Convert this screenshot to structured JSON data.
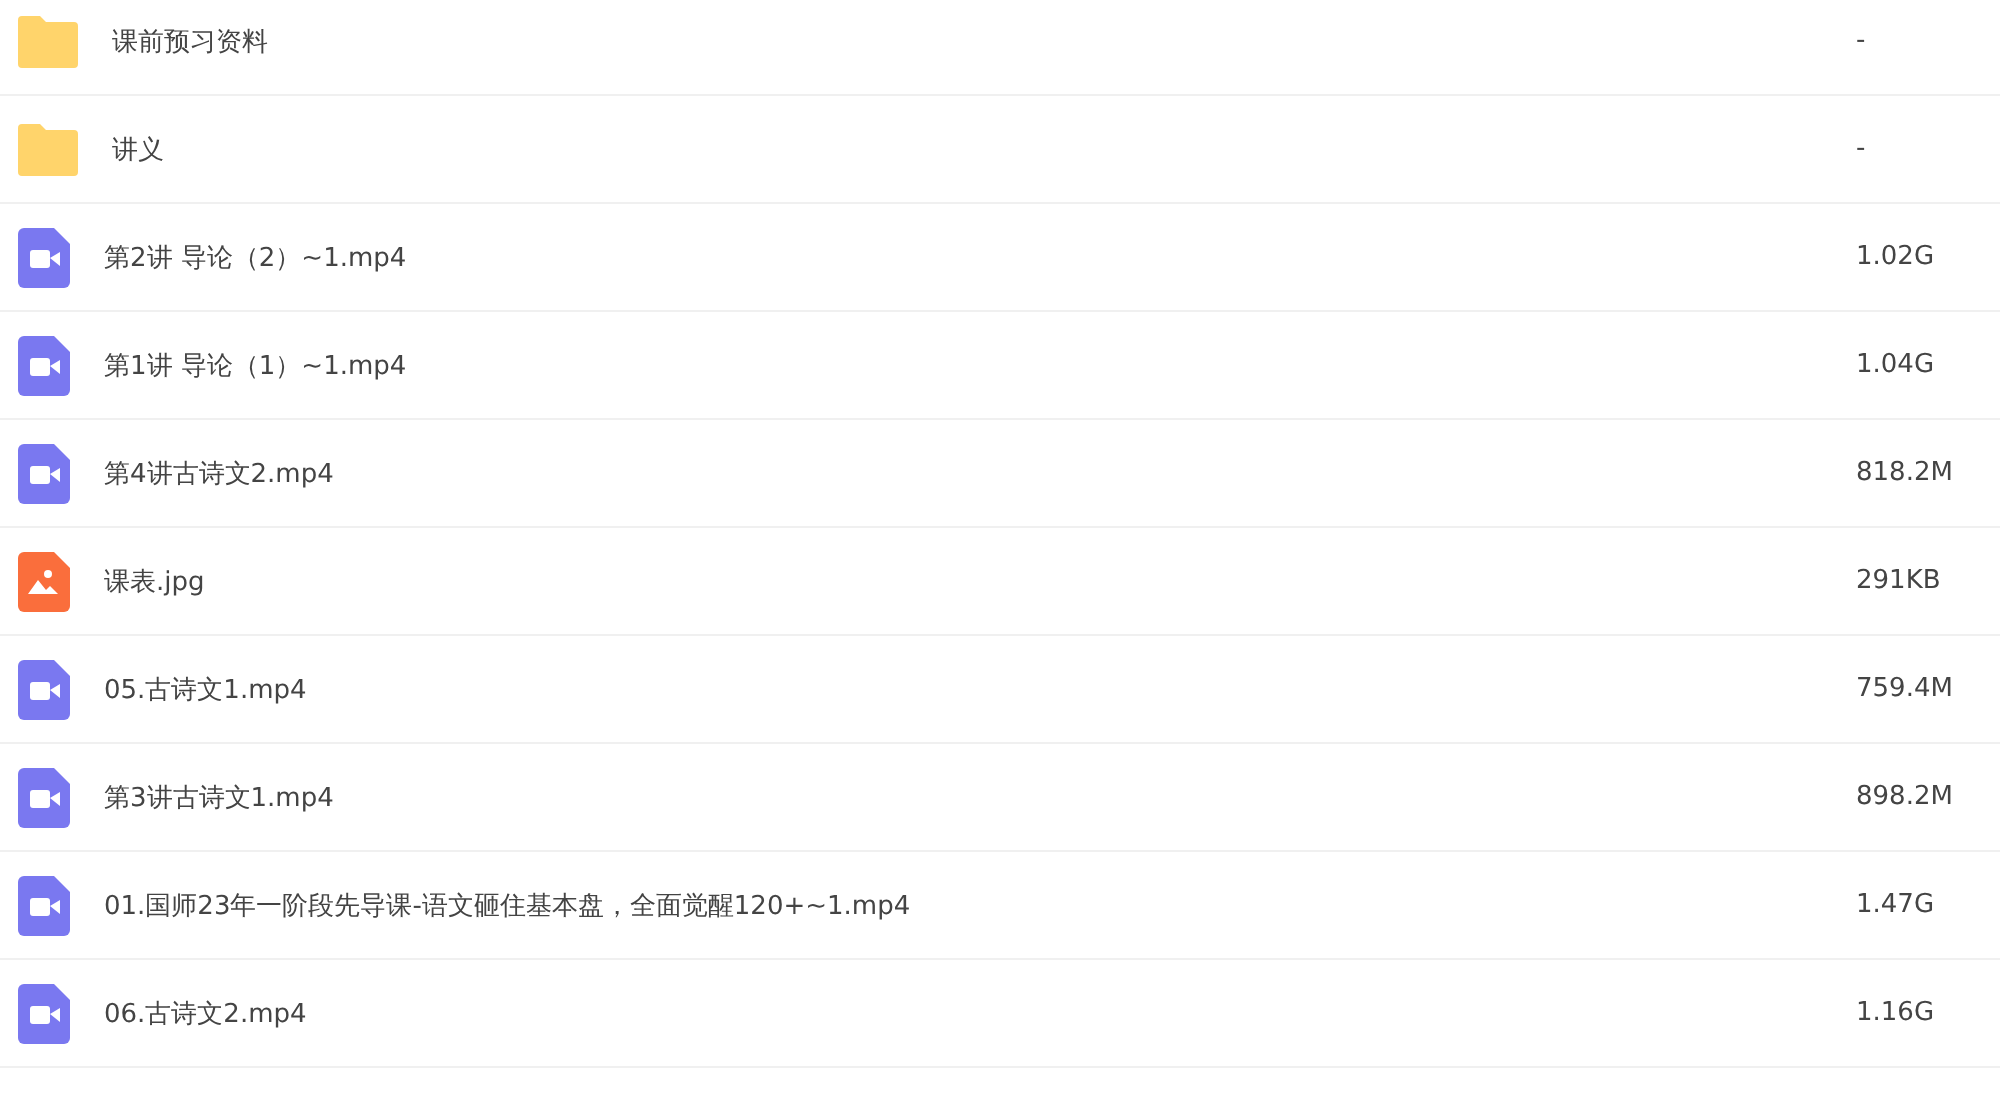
{
  "files": [
    {
      "kind": "folder",
      "name": "课前预习资料",
      "size": "-"
    },
    {
      "kind": "folder",
      "name": "讲义",
      "size": "-"
    },
    {
      "kind": "video",
      "name": "第2讲 导论（2）~1.mp4",
      "size": "1.02G"
    },
    {
      "kind": "video",
      "name": "第1讲 导论（1）~1.mp4",
      "size": "1.04G"
    },
    {
      "kind": "video",
      "name": "第4讲古诗文2.mp4",
      "size": "818.2M"
    },
    {
      "kind": "image",
      "name": "课表.jpg",
      "size": "291KB"
    },
    {
      "kind": "video",
      "name": "05.古诗文1.mp4",
      "size": "759.4M"
    },
    {
      "kind": "video",
      "name": "第3讲古诗文1.mp4",
      "size": "898.2M"
    },
    {
      "kind": "video",
      "name": "01.国师23年一阶段先导课-语文砸住基本盘，全面觉醒120+~1.mp4",
      "size": "1.47G"
    },
    {
      "kind": "video",
      "name": "06.古诗文2.mp4",
      "size": "1.16G"
    }
  ]
}
